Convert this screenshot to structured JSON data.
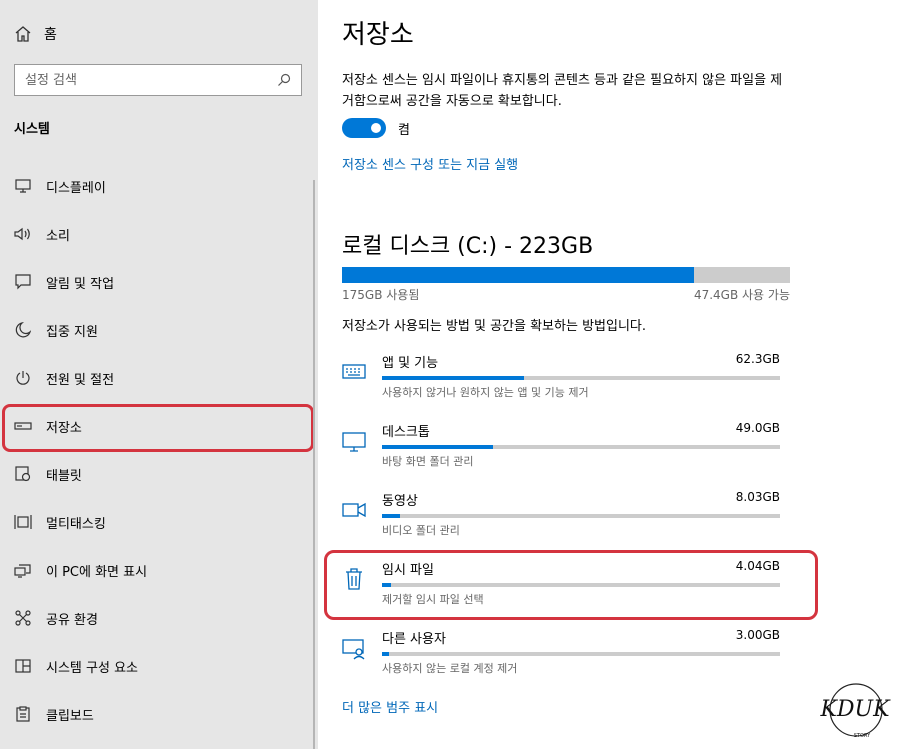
{
  "sidebar": {
    "home_label": "홈",
    "search_placeholder": "설정 검색",
    "section_title": "시스템",
    "items": [
      {
        "label": "디스플레이",
        "icon": "monitor-icon"
      },
      {
        "label": "소리",
        "icon": "speaker-icon"
      },
      {
        "label": "알림 및 작업",
        "icon": "notification-icon"
      },
      {
        "label": "집중 지원",
        "icon": "moon-icon"
      },
      {
        "label": "전원 및 절전",
        "icon": "power-icon"
      },
      {
        "label": "저장소",
        "icon": "storage-icon",
        "active": true
      },
      {
        "label": "태블릿",
        "icon": "tablet-icon"
      },
      {
        "label": "멀티태스킹",
        "icon": "multitasking-icon"
      },
      {
        "label": "이 PC에 화면 표시",
        "icon": "project-icon"
      },
      {
        "label": "공유 환경",
        "icon": "share-icon"
      },
      {
        "label": "시스템 구성 요소",
        "icon": "components-icon"
      },
      {
        "label": "클립보드",
        "icon": "clipboard-icon"
      }
    ]
  },
  "main": {
    "title": "저장소",
    "description": "저장소 센스는 임시 파일이나 휴지통의 콘텐츠 등과 같은 필요하지 않은 파일을 제거함으로써 공간을 자동으로 확보합니다.",
    "toggle_label": "켬",
    "toggle_on": true,
    "config_link": "저장소 센스 구성 또는 지금 실행",
    "disk": {
      "title": "로컬 디스크 (C:) - 223GB",
      "used_label": "175GB 사용됨",
      "free_label": "47.4GB 사용 가능",
      "used_fraction": 0.785
    },
    "usage_description": "저장소가 사용되는 방법 및 공간을 확보하는 방법입니다.",
    "categories": [
      {
        "name": "앱 및 기능",
        "size": "62.3GB",
        "sub": "사용하지 않거나 원하지 않는 앱 및 기능 제거",
        "fraction": 0.356,
        "icon": "apps-icon"
      },
      {
        "name": "데스크톱",
        "size": "49.0GB",
        "sub": "바탕 화면 폴더 관리",
        "fraction": 0.28,
        "icon": "desktop-icon"
      },
      {
        "name": "동영상",
        "size": "8.03GB",
        "sub": "비디오 폴더 관리",
        "fraction": 0.046,
        "icon": "video-icon"
      },
      {
        "name": "임시 파일",
        "size": "4.04GB",
        "sub": "제거할 임시 파일 선택",
        "fraction": 0.023,
        "icon": "trash-icon"
      },
      {
        "name": "다른 사용자",
        "size": "3.00GB",
        "sub": "사용하지 않는 로컬 계정 제거",
        "fraction": 0.017,
        "icon": "user-icon"
      }
    ],
    "more_link": "더 많은 범주 표시"
  },
  "watermark": {
    "text": "KDUK",
    "subtext": "STORY"
  }
}
